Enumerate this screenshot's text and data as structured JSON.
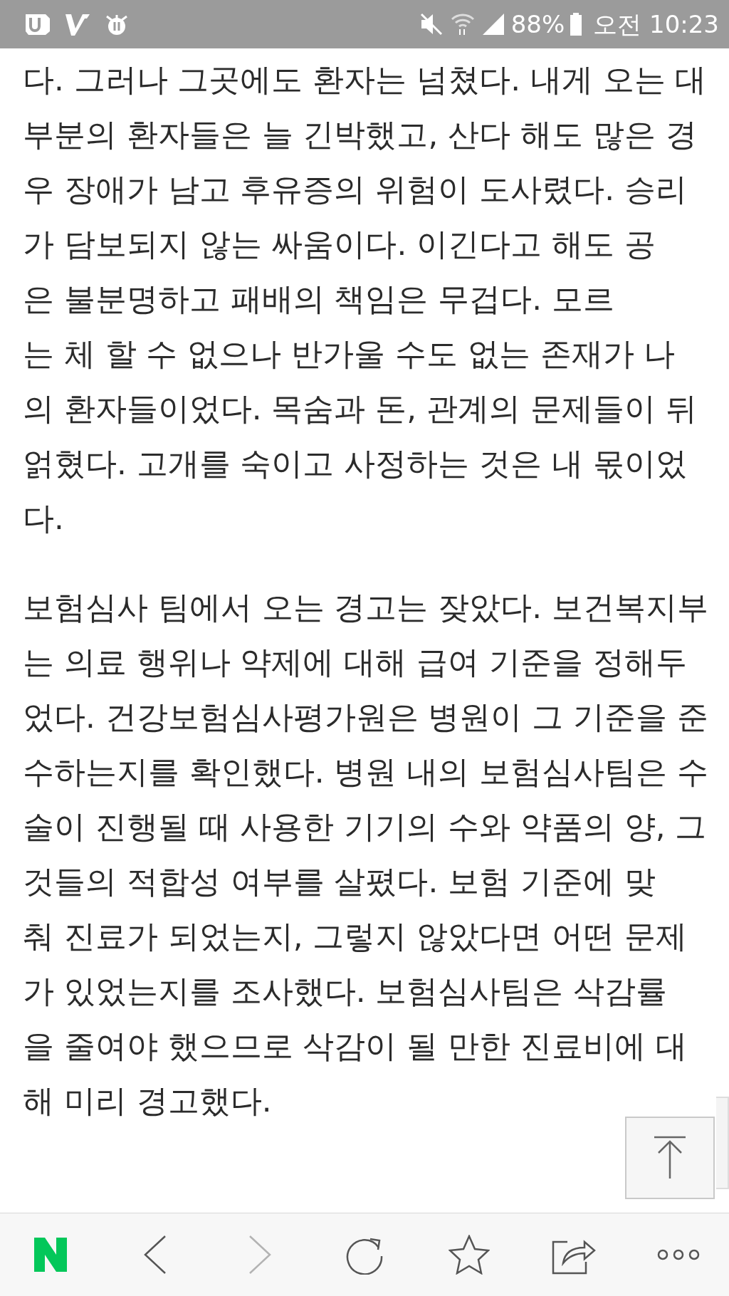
{
  "status_bar": {
    "battery": "88%",
    "time": "오전 10:23"
  },
  "paragraphs": [
    {
      "lines": [
        "다. 그러나 그곳에도 환자는 넘쳤다. 내게 오는 대",
        "부분의 환자들은 늘 긴박했고, 산다 해도 많은 경",
        "우 장애가 남고 후유증의 위험이 도사렸다. 승리",
        "가 담보되지 않는 싸움이다. 이긴다고 해도 공",
        "은 불분명하고 패배의 책임은 무겁다. 모르",
        "는 체 할 수 없으나 반가울 수도 없는 존재가 나",
        "의 환자들이었다. 목숨과 돈, 관계의 문제들이 뒤",
        "얽혔다. 고개를 숙이고 사정하는 것은 내 몫이었",
        "다."
      ]
    },
    {
      "lines": [
        "보험심사 팀에서 오는 경고는 잦았다. 보건복지부",
        "는 의료 행위나 약제에 대해 급여 기준을 정해두",
        "었다. 건강보험심사평가원은 병원이 그 기준을 준",
        "수하는지를 확인했다. 병원 내의 보험심사팀은 수",
        "술이 진행될 때 사용한 기기의 수와 약품의 양, 그",
        "것들의 적합성 여부를 살폈다. 보험 기준에 맞",
        "춰 진료가 되었는지, 그렇지 않았다면 어떤 문제",
        "가 있었는지를 조사했다. 보험심사팀은 삭감률",
        "을 줄여야 했으므로 삭감이 될 만한 진료비에 대",
        "해 미리 경고했다."
      ]
    }
  ],
  "toolbar": [
    {
      "kind": "home",
      "disabled": false
    },
    {
      "kind": "back",
      "disabled": false
    },
    {
      "kind": "forward",
      "disabled": true
    },
    {
      "kind": "reload",
      "disabled": false
    },
    {
      "kind": "bookmark",
      "disabled": false
    },
    {
      "kind": "share",
      "disabled": false
    },
    {
      "kind": "more",
      "disabled": false
    }
  ]
}
